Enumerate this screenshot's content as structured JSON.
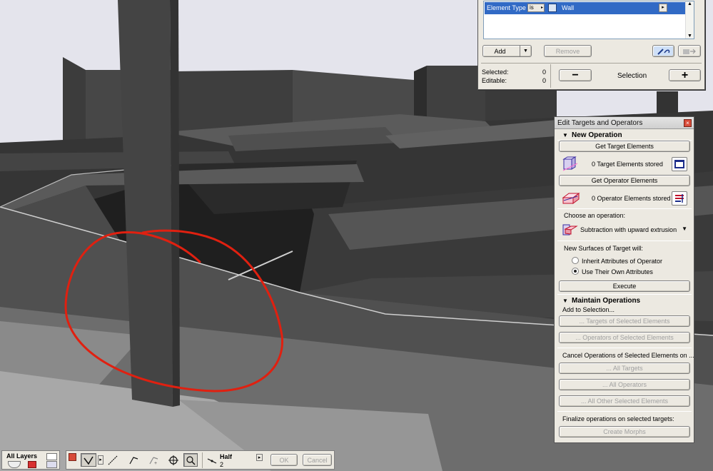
{
  "selection_panel": {
    "criteria": {
      "field": "Element Type",
      "operator": "is",
      "value": "Wall"
    },
    "add_label": "Add",
    "remove_label": "Remove",
    "selected_label": "Selected:",
    "selected_count": "0",
    "editable_label": "Editable:",
    "editable_count": "0",
    "minus_label": "−",
    "selection_label": "Selection",
    "plus_label": "+"
  },
  "eto_panel": {
    "title": "Edit Targets and Operators",
    "close_glyph": "×",
    "new_operation_header": "New Operation",
    "get_targets_label": "Get Target Elements",
    "targets_stored_text": "0  Target Elements stored",
    "get_operators_label": "Get Operator Elements",
    "operators_stored_text": "0  Operator Elements stored",
    "choose_operation_label": "Choose an operation:",
    "operation_value": "Subtraction with upward extrusion",
    "new_surfaces_label": "New Surfaces of Target will:",
    "option_inherit": "Inherit Attributes of Operator",
    "option_own": "Use Their Own Attributes",
    "selected_option": "own",
    "execute_label": "Execute",
    "maintain_header": "Maintain Operations",
    "add_to_selection_label": "Add to Selection...",
    "targets_of_selected_label": "... Targets of Selected Elements",
    "operators_of_selected_label": "... Operators of Selected Elements",
    "cancel_ops_label": "Cancel Operations of Selected Elements on ...",
    "all_targets_label": "... All Targets",
    "all_operators_label": "... All Operators",
    "all_other_label": "... All Other Selected Elements",
    "finalize_label": "Finalize operations on selected targets:",
    "create_morphs_label": "Create Morphs"
  },
  "layers_bar": {
    "title": "All Layers"
  },
  "tool_bar": {
    "geometry_title": "Half",
    "geometry_value": "2",
    "ok_label": "OK",
    "cancel_label": "Cancel"
  },
  "colors": {
    "sky": "#e4e4ec",
    "selection_highlight": "#316ac5",
    "annotation": "#e02010",
    "panel_bg": "#ece9e1"
  },
  "icons": {
    "close": "close-icon",
    "target": "target-elements-icon",
    "operator": "operator-elements-icon",
    "subtraction": "subtraction-operation-icon",
    "eyedropper": "eyedropper-icon"
  }
}
